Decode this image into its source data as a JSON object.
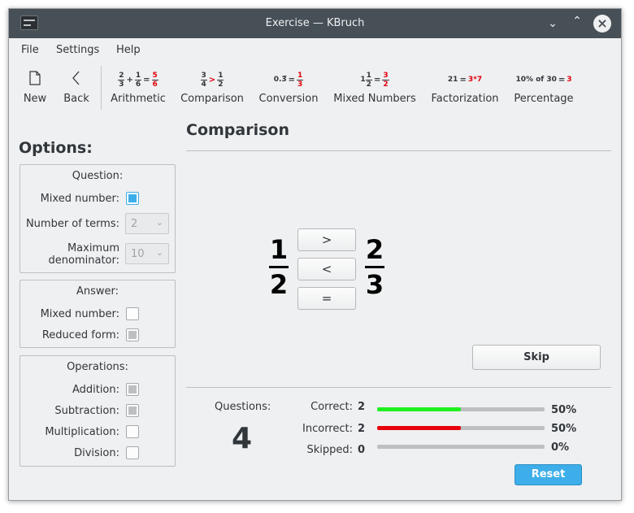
{
  "window": {
    "title": "Exercise — KBruch"
  },
  "menu": {
    "file": "File",
    "settings": "Settings",
    "help": "Help"
  },
  "toolbar": {
    "new": "New",
    "back": "Back",
    "arithmetic": {
      "label": "Arithmetic",
      "a_n": "2",
      "a_d": "3",
      "op": "+",
      "b_n": "1",
      "b_d": "6",
      "eq": "=",
      "r_n": "5",
      "r_d": "6"
    },
    "comparison": {
      "label": "Comparison",
      "a_n": "3",
      "a_d": "4",
      "op": ">",
      "b_n": "1",
      "b_d": "2"
    },
    "conversion": {
      "label": "Conversion",
      "value": "0.3̅",
      "eq": "=",
      "r_n": "1",
      "r_d": "3"
    },
    "mixed": {
      "label": "Mixed Numbers",
      "whole": "1",
      "a_n": "1",
      "a_d": "2",
      "eq": "=",
      "r_n": "3",
      "r_d": "2"
    },
    "factorization": {
      "label": "Factorization",
      "value": "21",
      "eq": "=",
      "result": "3*7"
    },
    "percentage": {
      "label": "Percentage",
      "value": "10% of 30",
      "eq": "=",
      "result": "3"
    }
  },
  "options": {
    "title": "Options:",
    "question": {
      "title": "Question:",
      "mixed_number": "Mixed number:",
      "num_terms_label": "Number of terms:",
      "num_terms_value": "2",
      "max_denom_label_1": "Maximum",
      "max_denom_label_2": "denominator:",
      "max_denom_value": "10"
    },
    "answer": {
      "title": "Answer:",
      "mixed_number": "Mixed number:",
      "reduced_form": "Reduced form:"
    },
    "operations": {
      "title": "Operations:",
      "addition": "Addition:",
      "subtraction": "Subtraction:",
      "multiplication": "Multiplication:",
      "division": "Division:"
    }
  },
  "exercise": {
    "title": "Comparison",
    "left": {
      "numerator": "1",
      "denominator": "2"
    },
    "right": {
      "numerator": "2",
      "denominator": "3"
    },
    "buttons": {
      "greater": ">",
      "less": "<",
      "equal": "="
    },
    "skip": "Skip"
  },
  "stats": {
    "questions_label": "Questions:",
    "questions_value": "4",
    "correct_label": "Correct:",
    "correct_value": "2",
    "correct_pct": "50%",
    "correct_fraction": 0.5,
    "incorrect_label": "Incorrect:",
    "incorrect_value": "2",
    "incorrect_pct": "50%",
    "incorrect_fraction": 0.5,
    "skipped_label": "Skipped:",
    "skipped_value": "0",
    "skipped_pct": "0%",
    "skipped_fraction": 0,
    "reset": "Reset",
    "correct_color": "#1ff01f",
    "incorrect_color": "#e8000c"
  }
}
